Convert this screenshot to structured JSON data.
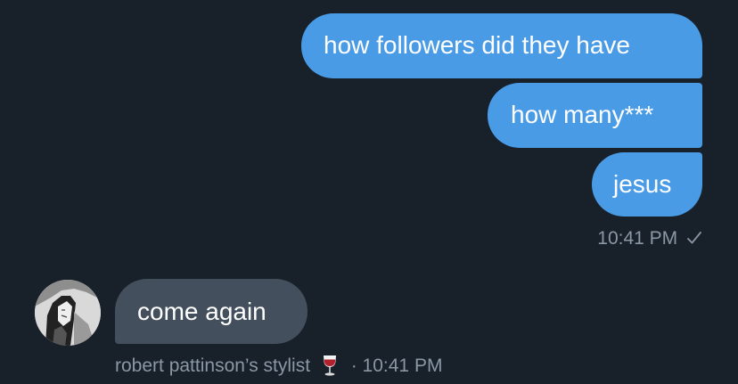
{
  "conversation": {
    "outgoing": [
      {
        "text": "how followers did they have"
      },
      {
        "text": "how many***"
      },
      {
        "text": "jesus"
      }
    ],
    "outgoing_time": "10:41 PM",
    "outgoing_status_icon": "single-check-icon",
    "incoming": [
      {
        "text": "come again"
      }
    ],
    "sender_name": "robert pattinson’s stylist",
    "sender_name_emoji_icon": "wine-glass-icon",
    "incoming_time": "· 10:41 PM"
  },
  "colors": {
    "background": "#18202a",
    "outgoing_bubble": "#4a9be6",
    "incoming_bubble": "#434f5c",
    "meta_text": "#8a97a4",
    "message_text": "#ffffff"
  }
}
